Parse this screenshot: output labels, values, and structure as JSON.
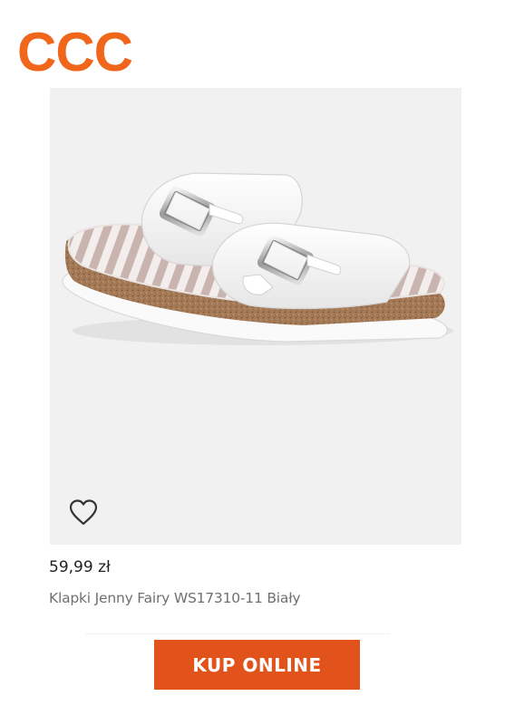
{
  "brand": {
    "logo_text": "CCC",
    "color": "#f0661b"
  },
  "product": {
    "image_alt": "Klapki Jenny Fairy WS17310-11 Biały",
    "favorite_icon": "heart-outline-icon",
    "price": "59,99 zł",
    "name": "Klapki Jenny Fairy WS17310-11 Biały"
  },
  "cta": {
    "label": "KUP ONLINE",
    "color": "#e2531c"
  }
}
